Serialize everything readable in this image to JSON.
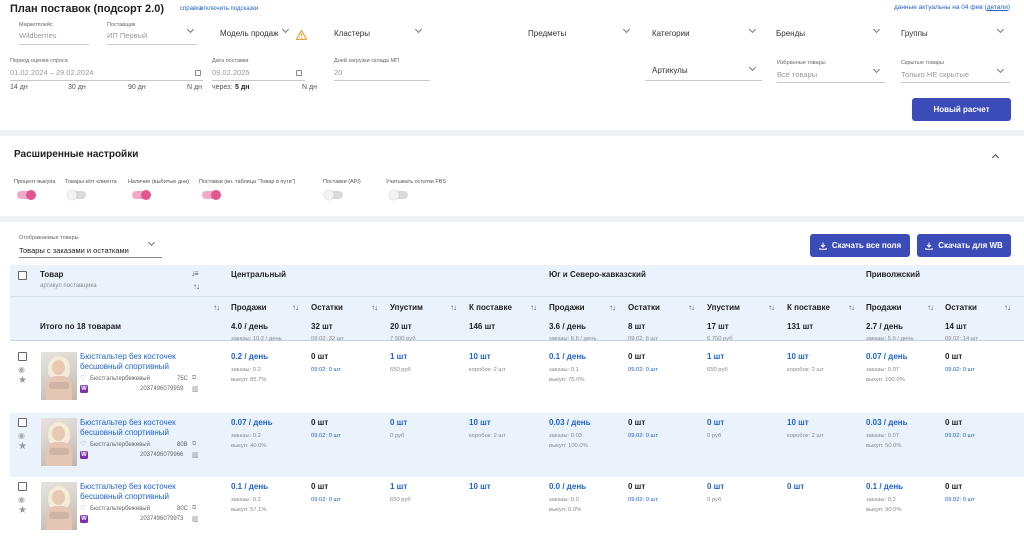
{
  "header": {
    "title": "План поставок (подсорт 2.0)",
    "help_link": "справка",
    "hints_link": "отключить подсказки",
    "actuality_text": "данные актуальны на 04 фев",
    "details_link": "детали"
  },
  "filters": {
    "marketplace": {
      "label": "Маркетплейс",
      "value": "Wildberries"
    },
    "supplier": {
      "label": "Поставщик",
      "value": "ИП Первый"
    },
    "sales_model": {
      "value": "Модель продаж"
    },
    "clusters": {
      "value": "Кластеры"
    },
    "subjects": {
      "value": "Предметы"
    },
    "categories": {
      "value": "Категории"
    },
    "brands": {
      "value": "Бренды"
    },
    "groups": {
      "value": "Группы"
    },
    "demand_period": {
      "label": "Период оценки спроса",
      "value": "01.02.2024 – 29.02.2024"
    },
    "period_presets": [
      "14 дн",
      "30 дн",
      "90 дн",
      "N дн"
    ],
    "delivery_date": {
      "label": "Дата поставки",
      "value": "09.02.2025"
    },
    "delivery_in_prefix": "через:",
    "delivery_in_value": "5 дн",
    "delivery_n": "N дн",
    "warehouse_days": {
      "label": "Дней загрузки склада МП",
      "value": "20"
    },
    "articles": {
      "value": "Артикулы"
    },
    "favorites": {
      "label": "Избранные товары",
      "value": "Все товары"
    },
    "hidden": {
      "label": "Скрытые товары",
      "value": "Только НЕ скрытые"
    },
    "new_calc_button": "Новый расчет"
  },
  "advanced": {
    "title": "Расширенные настройки",
    "toggles": [
      {
        "label": "Процент выкупа",
        "on": true
      },
      {
        "label": "Товары к/от клиента",
        "on": false
      },
      {
        "label": "Наличие (выбитые дни)",
        "on": true
      },
      {
        "label": "Поставки (вн. таблица \"Товар в пути\")",
        "on": true
      },
      {
        "label": "Поставки (API)",
        "on": false
      },
      {
        "label": "Учитывать остатки FBS",
        "on": false
      }
    ]
  },
  "table_controls": {
    "shown_label": "Отображаемые товары",
    "shown_value": "Товары с заказами и остатками",
    "download_all": "Скачать все поля",
    "download_wb": "Скачать для WB"
  },
  "table": {
    "product_header": "Товар",
    "product_sub": "артикул поставщика",
    "regions": [
      "Центральный",
      "Юг и Северо-кавказский",
      "Приволжский"
    ],
    "columns": [
      "Продажи",
      "Остатки",
      "Упустим",
      "К поставке",
      "Продажи",
      "Остатки",
      "Упустим",
      "К поставке",
      "Продажи",
      "Остатки"
    ],
    "totals": {
      "label": "Итого по 18 товарам",
      "main": [
        "4.0 / день",
        "32 шт",
        "20 шт",
        "146 шт",
        "3.6 / день",
        "8 шт",
        "17 шт",
        "131 шт",
        "2.7 / день",
        "14 шт"
      ],
      "sub": [
        "заказы: 10.2 / день",
        "09.02: 32 шт",
        "7 500 руб",
        "",
        "заказы: 6.6 / день",
        "09.02: 8 шт",
        "6 750 руб",
        "",
        "заказы: 5.6 / день",
        "09.02: 14 шт"
      ]
    },
    "rows": [
      {
        "name": "Бюстгальтер без косточек бесшовный спортивный",
        "color": "Бюстгальтербежевый",
        "size": "75C",
        "sku": "2037496079959",
        "main": [
          "0.2 / день",
          "0 шт",
          "1 шт",
          "10 шт",
          "0.1 / день",
          "0 шт",
          "1 шт",
          "10 шт",
          "0.07 / день",
          "0 шт"
        ],
        "sub1": [
          "заказы: 0.2",
          "09.02: 0 шт",
          "650 руб",
          "коробок: 2 шт",
          "заказы: 0.1",
          "09.02: 0 шт",
          "650 руб",
          "коробок: 2 шт",
          "заказы: 0.07",
          "09.02: 0 шт"
        ],
        "sub2": [
          "выкуп: 85.7%",
          "",
          "",
          "",
          "выкуп: 75.0%",
          "",
          "",
          "",
          "выкуп: 100.0%",
          ""
        ]
      },
      {
        "name": "Бюстгальтер без косточек бесшовный спортивный",
        "color": "Бюстгальтербежевый",
        "size": "80B",
        "sku": "2037496079966",
        "main": [
          "0.07 / день",
          "0 шт",
          "0 шт",
          "10 шт",
          "0.03 / день",
          "0 шт",
          "0 шт",
          "10 шт",
          "0.03 / день",
          "0 шт"
        ],
        "sub1": [
          "заказы: 0.2",
          "09.02: 0 шт",
          "0 руб",
          "коробок: 2 шт",
          "заказы: 0.03",
          "09.02: 0 шт",
          "0 руб",
          "коробок: 2 шт",
          "заказы: 0.07",
          "09.02: 0 шт"
        ],
        "sub2": [
          "выкуп: 40.0%",
          "",
          "",
          "",
          "выкуп: 100.0%",
          "",
          "",
          "",
          "выкуп: 50.0%",
          ""
        ]
      },
      {
        "name": "Бюстгальтер без косточек бесшовный спортивный",
        "color": "Бюстгальтербежевый",
        "size": "80C",
        "sku": "2037496079973",
        "main": [
          "0.1 / день",
          "0 шт",
          "1 шт",
          "10 шт",
          "0.0 / день",
          "0 шт",
          "0 шт",
          "0 шт",
          "0.1 / день",
          "0 шт"
        ],
        "sub1": [
          "заказы: 0.2",
          "09.02: 0 шт",
          "650 руб",
          "",
          "заказы: 0.0",
          "09.02: 0 шт",
          "0 руб",
          "",
          "заказы: 0.2",
          "09.02: 0 шт"
        ],
        "sub2": [
          "выкуп: 57.1%",
          "",
          "",
          "",
          "выкуп: 0.0%",
          "",
          "",
          "",
          "выкуп: 90.0%",
          ""
        ]
      }
    ]
  },
  "colors": {
    "accent": "#3b4cb8",
    "link": "#1e63c8",
    "toggle_on": "#e2558f",
    "warning": "#e6a23c"
  }
}
